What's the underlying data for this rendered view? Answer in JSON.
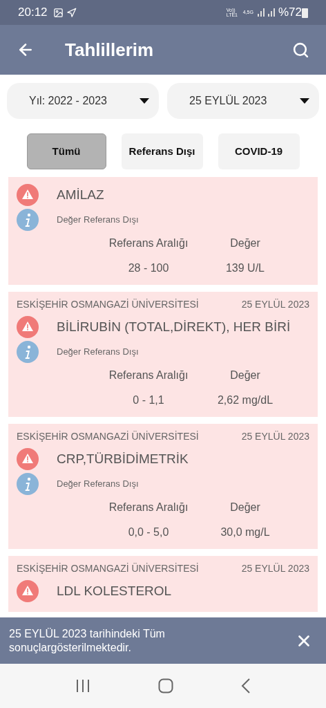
{
  "status_bar": {
    "time": "20:12",
    "network": "Vo)) LTE1",
    "data": "4,5G",
    "battery": "%72"
  },
  "app_bar": {
    "title": "Tahlillerim"
  },
  "dropdowns": [
    {
      "value": "Yıl: 2022 - 2023"
    },
    {
      "value": "25 EYLÜL 2023"
    }
  ],
  "filters": [
    {
      "label": "Tümü",
      "selected": true
    },
    {
      "label": "Referans Dışı",
      "selected": false
    },
    {
      "label": "COVID-19",
      "selected": false
    }
  ],
  "results": [
    {
      "test": "AMİLAZ",
      "status": "Değer Referans Dışı",
      "range_label": "Referans Aralığı",
      "value_label": "Değer",
      "range": "28 - 100",
      "value": "139 U/L"
    },
    {
      "institution": "ESKİŞEHİR OSMANGAZİ ÜNİVERSİTESİ",
      "date": "25 EYLÜL 2023",
      "test": "BİLİRUBİN (TOTAL,DİREKT), HER BİRİ",
      "status": "Değer Referans Dışı",
      "range_label": "Referans Aralığı",
      "value_label": "Değer",
      "range": "0 - 1,1",
      "value": "2,62 mg/dL"
    },
    {
      "institution": "ESKİŞEHİR OSMANGAZİ ÜNİVERSİTESİ",
      "date": "25 EYLÜL 2023",
      "test": "CRP,TÜRBİDİMETRİK",
      "status": "Değer Referans Dışı",
      "range_label": "Referans Aralığı",
      "value_label": "Değer",
      "range": "0,0 - 5,0",
      "value": "30,0 mg/L"
    },
    {
      "institution": "ESKİŞEHİR OSMANGAZİ ÜNİVERSİTESİ",
      "date": "25 EYLÜL 2023",
      "test": "LDL KOLESTEROL"
    }
  ],
  "snackbar": {
    "message": "25 EYLÜL 2023 tarihindeki Tüm sonuçlargösterilmektedir."
  }
}
